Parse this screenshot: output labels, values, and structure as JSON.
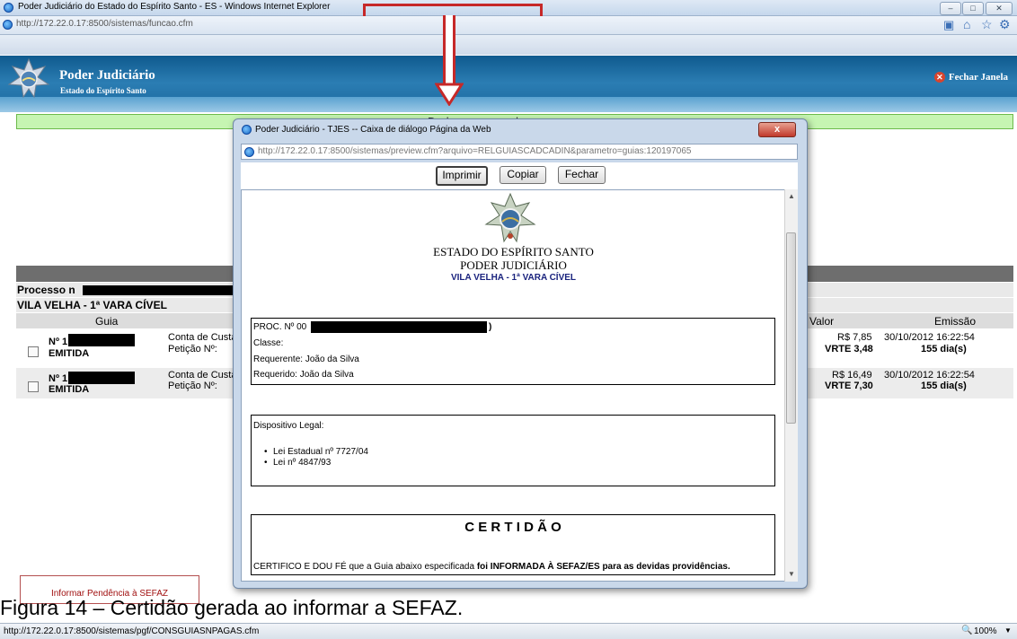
{
  "browser": {
    "window_title": "Poder Judiciário do Estado do Espírito Santo - ES - Windows Internet Explorer",
    "url": "http://172.22.0.17:8500/sistemas/funcao.cfm",
    "status_url": "http://172.22.0.17:8500/sistemas/pgf/CONSGUIASNPAGAS.cfm",
    "zoom": "100%"
  },
  "app": {
    "brand_title": "Poder Judiciário",
    "brand_subtitle": "Estado do Espírito Santo",
    "close_window": "Fechar Janela",
    "success_message": "Dados processados com sucesso",
    "process_label": "Processo n",
    "vara": "VILA VELHA - 1ª VARA CÍVEL",
    "headers": {
      "guia": "Guia",
      "valor": "Valor",
      "emissao": "Emissão"
    },
    "rows": [
      {
        "numero": "Nº 1",
        "status": "EMITIDA",
        "tipo": "Conta de Custa",
        "peticao": "Petição Nº:",
        "valor": "R$ 7,85",
        "vrte": "VRTE 3,48",
        "emissao": "30/10/2012 16:22:54",
        "dias": "155 dia(s)"
      },
      {
        "numero": "Nº 1",
        "status": "EMITIDA",
        "tipo": "Conta de Custa",
        "peticao": "Petição Nº:",
        "valor": "R$ 16,49",
        "vrte": "VRTE 7,30",
        "emissao": "30/10/2012 16:22:54",
        "dias": "155 dia(s)"
      }
    ],
    "pendencia_button": "Informar Pendência à SEFAZ"
  },
  "dialog": {
    "title": "Poder Judiciário - TJES -- Caixa de diálogo Página da Web",
    "url": "http://172.22.0.17:8500/sistemas/preview.cfm?arquivo=RELGUIASCADCADIN&parametro=guias:120197065",
    "close_label": "x",
    "buttons": {
      "imprimir": "Imprimir",
      "copiar": "Copiar",
      "fechar": "Fechar"
    },
    "doc": {
      "estado": "ESTADO DO ESPÍRITO SANTO",
      "poder": "PODER JUDICIÁRIO",
      "vara": "VILA VELHA - 1ª VARA CÍVEL",
      "proc_label": "PROC. Nº 00",
      "proc_suffix": ")",
      "classe": "Classe:",
      "requerente": "Requerente: João da Silva",
      "requerido": "Requerido: João da Silva",
      "dispositivo": "Dispositivo Legal:",
      "leis": [
        "Lei Estadual nº 7727/04",
        "Lei nº 4847/93"
      ],
      "certidao_title": "C E R T I D Ã O",
      "certifico_start": "CERTIFICO E DOU FÉ que a Guia abaixo especificada ",
      "certifico_bold": "foi INFORMADA À SEFAZ/ES para as devidas providências."
    }
  },
  "caption": "Figura 14 – Certidão gerada ao informar a SEFAZ.",
  "colors": {
    "header": "#1f6da3",
    "success": "#c6f5b2",
    "arrow": "#c62828",
    "dialog_frame": "#c9d8ea"
  }
}
